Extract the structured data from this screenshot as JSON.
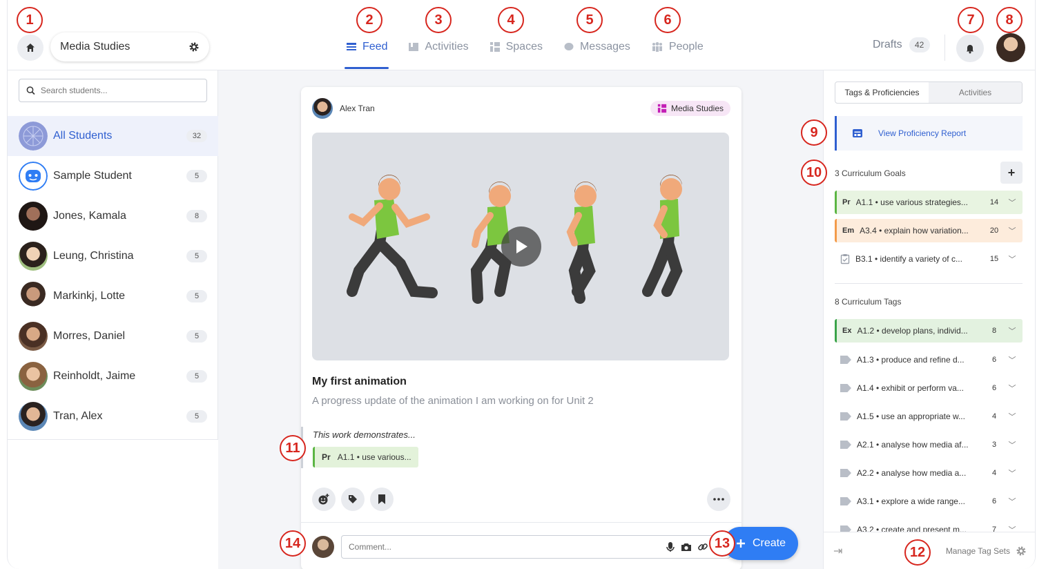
{
  "header": {
    "class_name": "Media Studies",
    "nav_tabs": [
      {
        "label": "Feed",
        "icon": "feed-icon",
        "active": true
      },
      {
        "label": "Activities",
        "icon": "activities-icon"
      },
      {
        "label": "Spaces",
        "icon": "spaces-icon"
      },
      {
        "label": "Messages",
        "icon": "messages-icon"
      },
      {
        "label": "People",
        "icon": "people-icon"
      }
    ],
    "drafts_label": "Drafts",
    "drafts_count": "42"
  },
  "sidebar": {
    "search_placeholder": "Search students...",
    "students": [
      {
        "name": "All Students",
        "count": "32"
      },
      {
        "name": "Sample Student",
        "count": "5"
      },
      {
        "name": "Jones, Kamala",
        "count": "8"
      },
      {
        "name": "Leung, Christina",
        "count": "5"
      },
      {
        "name": "Markinkj, Lotte",
        "count": "5"
      },
      {
        "name": "Morres, Daniel",
        "count": "5"
      },
      {
        "name": "Reinholdt, Jaime",
        "count": "5"
      },
      {
        "name": "Tran, Alex",
        "count": "5"
      }
    ]
  },
  "post": {
    "author": "Alex Tran",
    "class_tag": "Media Studies",
    "title": "My first animation",
    "description": "A progress update of the animation I am working on for Unit 2",
    "demonstrates_label": "This work demonstrates...",
    "evidence_code": "Pr",
    "evidence_text": "A1.1 • use various...",
    "comment_placeholder": "Comment..."
  },
  "create_label": "Create",
  "right_panel": {
    "tabs": [
      "Tags & Proficiencies",
      "Activities"
    ],
    "report_label": "View Proficiency Report",
    "goals_header": "3 Curriculum Goals",
    "goals": [
      {
        "code": "Pr",
        "text": "A1.1 • use various strategies...",
        "count": "14",
        "color": "#5bb543"
      },
      {
        "code": "Em",
        "text": "A3.4 • explain how variation...",
        "count": "20",
        "color": "#f39b4a"
      },
      {
        "code": "",
        "text": "B3.1 • identify a variety of c...",
        "count": "15",
        "color": ""
      }
    ],
    "tags_header": "8 Curriculum Tags",
    "tags": [
      {
        "code": "Ex",
        "text": "A1.2 • develop plans, individ...",
        "count": "8",
        "color": "#3aa34a"
      },
      {
        "code": "",
        "text": "A1.3 • produce and refine d...",
        "count": "6"
      },
      {
        "code": "",
        "text": "A1.4 • exhibit or perform va...",
        "count": "6"
      },
      {
        "code": "",
        "text": "A1.5 • use an appropriate w...",
        "count": "4"
      },
      {
        "code": "",
        "text": "A2.1 • analyse how media af...",
        "count": "3"
      },
      {
        "code": "",
        "text": "A2.2 • analyse how media a...",
        "count": "4"
      },
      {
        "code": "",
        "text": "A3.1 • explore a wide range...",
        "count": "6"
      },
      {
        "code": "",
        "text": "A3.2 • create and present m...",
        "count": "7"
      }
    ],
    "manage_label": "Manage Tag Sets"
  },
  "callouts": [
    "1",
    "2",
    "3",
    "4",
    "5",
    "6",
    "7",
    "8",
    "9",
    "10",
    "11",
    "12",
    "13",
    "14"
  ],
  "colors": {
    "accent": "#2f5fd0",
    "create": "#2f7df4",
    "callout": "#d7261e"
  }
}
